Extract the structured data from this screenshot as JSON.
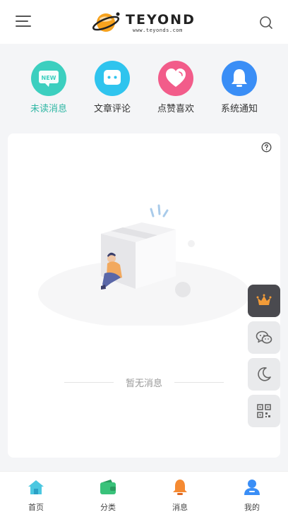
{
  "header": {
    "brand_name": "TEYOND",
    "brand_url": "www.teyonds.com",
    "menu_icon": "hamburger-menu-icon",
    "search_icon": "search-icon"
  },
  "categories": [
    {
      "label": "未读消息",
      "icon": "new-badge-icon",
      "color": "#3ccfbf",
      "active": true
    },
    {
      "label": "文章评论",
      "icon": "comment-bubble-icon",
      "color": "#2fc4ee",
      "active": false
    },
    {
      "label": "点赞喜欢",
      "icon": "heart-icon",
      "color": "#f25c8a",
      "active": false
    },
    {
      "label": "系统通知",
      "icon": "bell-icon",
      "color": "#3a8ef6",
      "active": false
    }
  ],
  "content": {
    "help_icon": "question-circle-icon",
    "empty_text": "暂无消息",
    "illustration": "empty-box-illustration"
  },
  "float_buttons": [
    {
      "icon": "crown-icon"
    },
    {
      "icon": "wechat-icon"
    },
    {
      "icon": "moon-icon"
    },
    {
      "icon": "qr-code-icon"
    }
  ],
  "bottom_nav": [
    {
      "label": "首页",
      "icon": "home-icon"
    },
    {
      "label": "分类",
      "icon": "wallet-icon"
    },
    {
      "label": "消息",
      "icon": "bell-icon"
    },
    {
      "label": "我的",
      "icon": "user-icon"
    }
  ],
  "colors": {
    "accent": "#2fb7a4",
    "background": "#f4f5f7"
  }
}
